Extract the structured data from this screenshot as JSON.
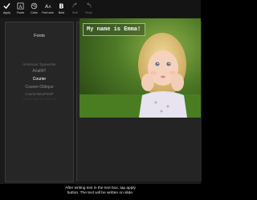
{
  "toolbar": {
    "items": [
      {
        "label": "Apply",
        "icon": "check-icon",
        "enabled": true
      },
      {
        "label": "Fonts",
        "icon": "fonts-icon",
        "enabled": true
      },
      {
        "label": "Color",
        "icon": "color-icon",
        "enabled": true
      },
      {
        "label": "Font size",
        "icon": "font-size-icon",
        "enabled": true
      },
      {
        "label": "Bold",
        "icon": "bold-icon",
        "enabled": true
      },
      {
        "label": "Shift",
        "icon": "shift-icon",
        "enabled": false
      },
      {
        "label": "Redo",
        "icon": "redo-icon",
        "enabled": false
      }
    ]
  },
  "fonts_panel": {
    "title": "Fonts",
    "items": [
      {
        "label": "American Typewriter",
        "state": "faded"
      },
      {
        "label": "ArialMT",
        "state": "dim"
      },
      {
        "label": "Courier",
        "state": "selected"
      },
      {
        "label": "Courier-Oblique",
        "state": "dim"
      },
      {
        "label": "CourierNewPSMT",
        "state": "faded"
      },
      {
        "label": "Courier New PS Italic MT",
        "state": "very-faded"
      }
    ]
  },
  "canvas": {
    "text_box_value": "My name is Emma!",
    "photo_subject": "girl-photo"
  },
  "hint": {
    "line1": "After writing text in the text box, tap apply",
    "line2": "button. The text will be written on slide."
  },
  "colors": {
    "background": "#000000",
    "panel": "#262626",
    "text_box_border": "#9fbf7f"
  }
}
